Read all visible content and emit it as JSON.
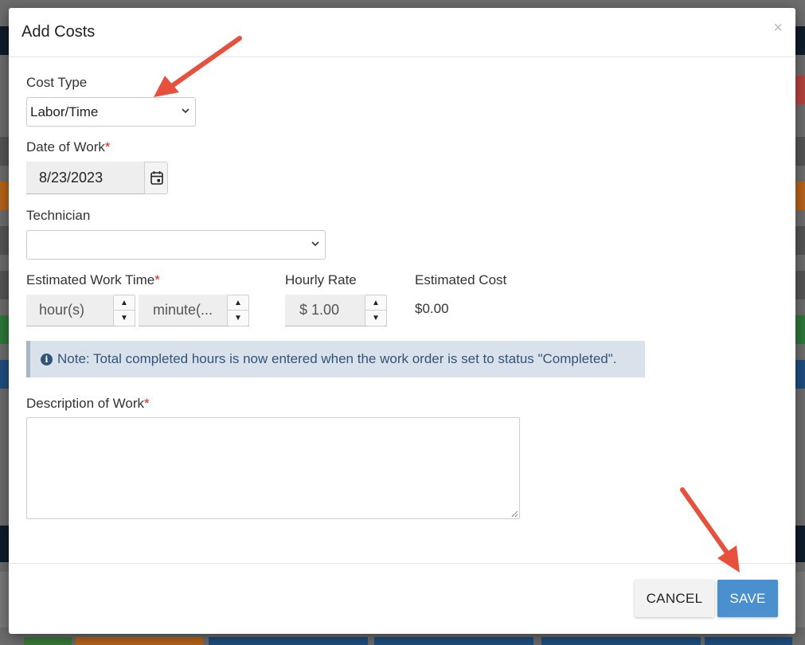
{
  "modal": {
    "title": "Add Costs",
    "close_glyph": "×"
  },
  "form": {
    "cost_type": {
      "label": "Cost Type",
      "value": "Labor/Time"
    },
    "date_of_work": {
      "label": "Date of Work",
      "required_mark": "*",
      "value": "8/23/2023",
      "icon": "calendar-icon"
    },
    "technician": {
      "label": "Technician",
      "value": ""
    },
    "estimated_work_time": {
      "label": "Estimated Work Time",
      "required_mark": "*",
      "hours_placeholder": "hour(s)",
      "minutes_placeholder": "minute(..."
    },
    "hourly_rate": {
      "label": "Hourly Rate",
      "value": "$ 1.00"
    },
    "estimated_cost": {
      "label": "Estimated Cost",
      "value": "$0.00"
    },
    "note": {
      "icon": "info-icon",
      "text": "Note: Total completed hours is now entered when the work order is set to status \"Completed\"."
    },
    "description": {
      "label": "Description of Work",
      "required_mark": "*",
      "value": ""
    }
  },
  "footer": {
    "cancel_label": "CANCEL",
    "save_label": "SAVE"
  },
  "annotations": {
    "arrow_color": "#e8503e"
  },
  "colors": {
    "primary": "#4a90cf",
    "required": "#d9261c",
    "note_bg": "#d9e1ea",
    "note_text": "#31557a"
  }
}
